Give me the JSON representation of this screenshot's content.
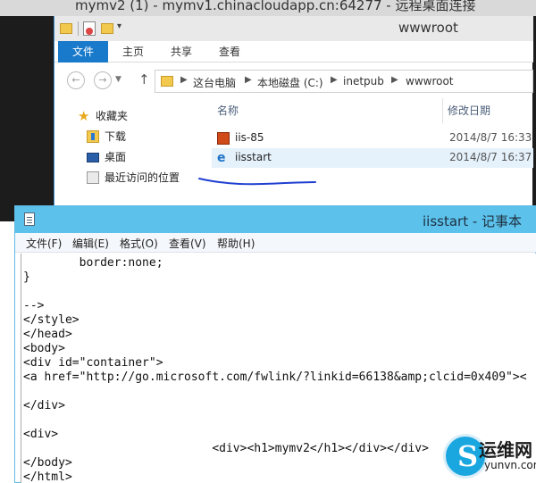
{
  "remote_desktop": {
    "title": "mymv2 (1) - mymv1.chinacloudapp.cn:64277 - 远程桌面连接"
  },
  "explorer": {
    "title": "wwwroot",
    "ribbon_tabs": [
      "文件",
      "主页",
      "共享",
      "查看"
    ],
    "address_path": [
      "这台电脑",
      "本地磁盘 (C:)",
      "inetpub",
      "wwwroot"
    ],
    "nav_pane": [
      {
        "label": "收藏夹",
        "icon": "star-icon"
      },
      {
        "label": "下载",
        "icon": "downloads-folder-icon"
      },
      {
        "label": "桌面",
        "icon": "desktop-icon"
      },
      {
        "label": "最近访问的位置",
        "icon": "recent-places-icon"
      }
    ],
    "columns": {
      "name": "名称",
      "date": "修改日期"
    },
    "files": [
      {
        "name": "iis-85",
        "date": "2014/8/7 16:33",
        "icon": "image-file-icon",
        "selected": false
      },
      {
        "name": "iisstart",
        "date": "2014/8/7 16:37",
        "icon": "ie-html-icon",
        "selected": true
      }
    ],
    "annotation_color": "#1f3fd1"
  },
  "notepad": {
    "title": "iisstart - 记事本",
    "menu": [
      "文件(F)",
      "编辑(E)",
      "格式(O)",
      "查看(V)",
      "帮助(H)"
    ],
    "lines": [
      "        border:none;",
      "}",
      "",
      "-->",
      "</style>",
      "</head>",
      "<body>",
      "<div id=\"container\">",
      "<a href=\"http://go.microsoft.com/fwlink/?linkid=66138&amp;clcid=0x409\"><",
      "",
      "</div>",
      "",
      "<div>",
      "                           <div><h1>mymv2</h1></div></div>",
      "</body>",
      "</html>"
    ]
  },
  "watermark": {
    "text": "运维网",
    "url": "yunvn.com"
  },
  "colors": {
    "ribbon_file_tab": "#1979ca",
    "notepad_titlebar": "#5cc2ec",
    "selection": "#e5f1fb"
  }
}
